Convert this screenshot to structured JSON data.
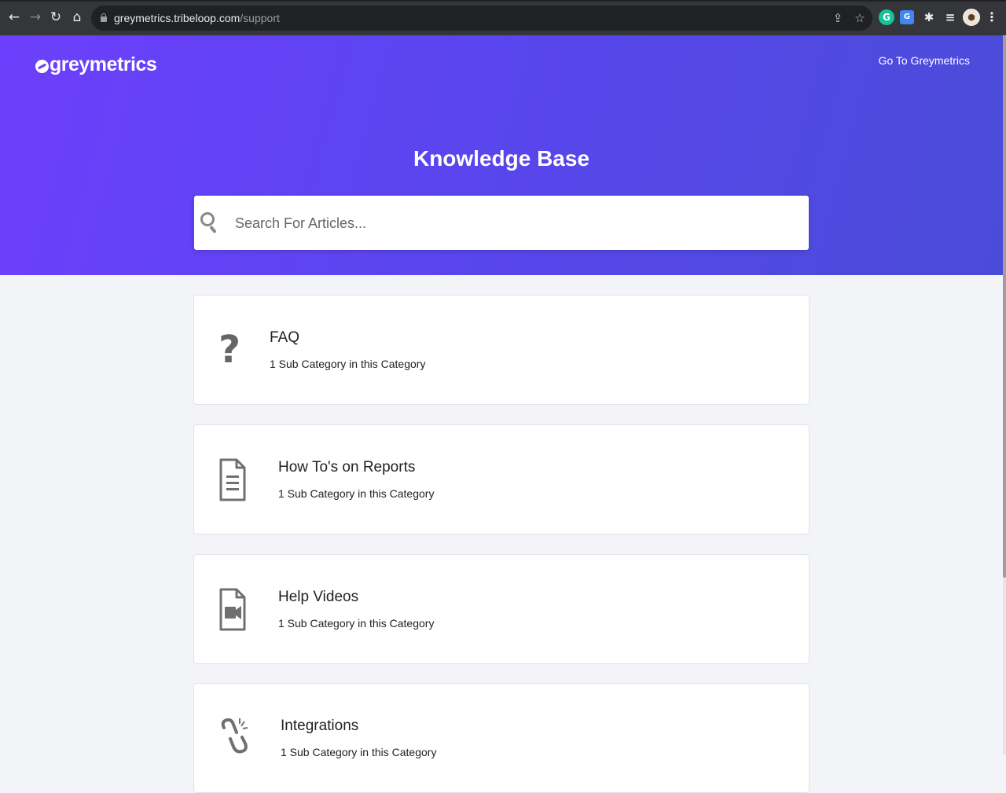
{
  "browser": {
    "url_host": "greymetrics.tribeloop.com",
    "url_path": "/support"
  },
  "header": {
    "logo_text": "greymetrics",
    "go_link": "Go To Greymetrics",
    "title": "Knowledge Base"
  },
  "search": {
    "placeholder": "Search For Articles..."
  },
  "categories": [
    {
      "title": "FAQ",
      "subtitle": "1 Sub Category in this Category",
      "icon": "question-icon"
    },
    {
      "title": "How To's on Reports",
      "subtitle": "1 Sub Category in this Category",
      "icon": "document-icon"
    },
    {
      "title": "Help Videos",
      "subtitle": "1 Sub Category in this Category",
      "icon": "video-file-icon"
    },
    {
      "title": "Integrations",
      "subtitle": "1 Sub Category in this Category",
      "icon": "broken-link-icon"
    }
  ]
}
